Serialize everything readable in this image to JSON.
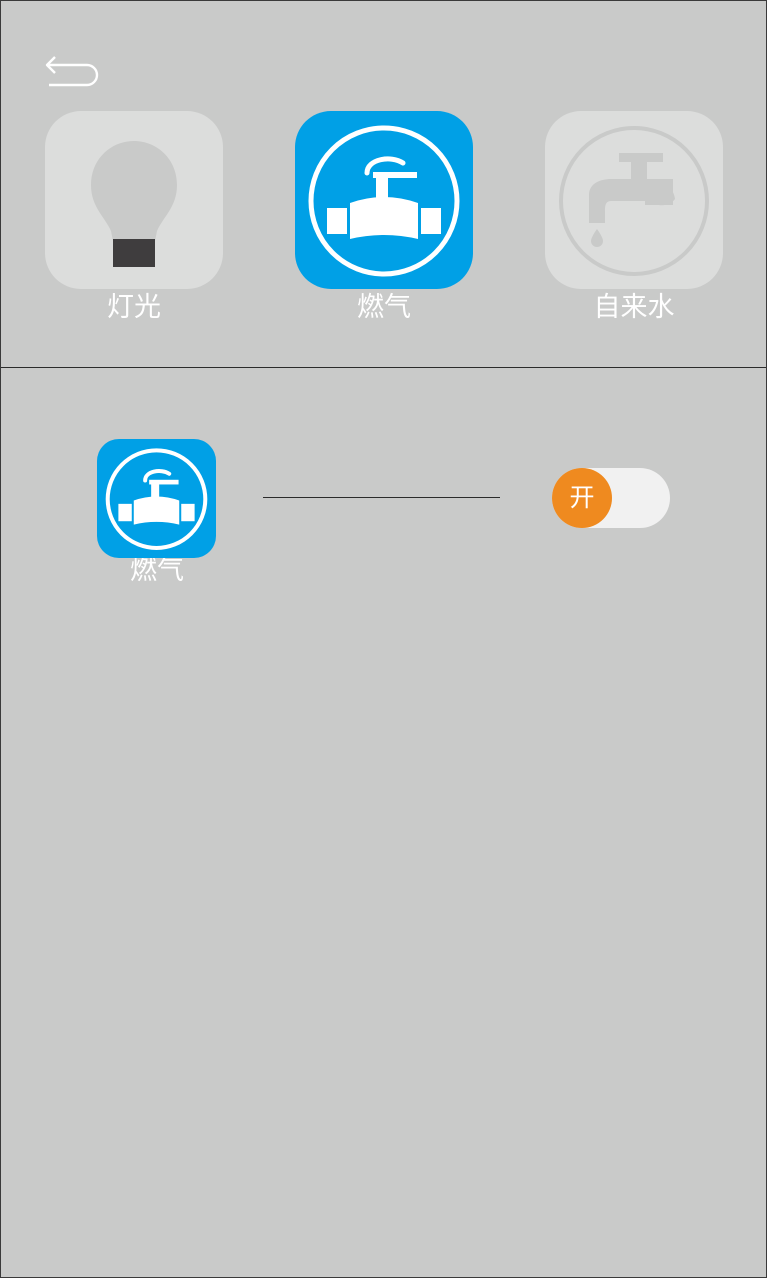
{
  "header": {
    "back_icon": "back-arrow-icon"
  },
  "categories": [
    {
      "label": "灯光",
      "icon": "light-bulb-icon",
      "selected": false
    },
    {
      "label": "燃气",
      "icon": "gas-valve-icon",
      "selected": true
    },
    {
      "label": "自来水",
      "icon": "water-faucet-icon",
      "selected": false
    }
  ],
  "device": {
    "label": "燃气",
    "icon": "gas-valve-icon",
    "toggle_label": "开",
    "toggle_on": true
  },
  "colors": {
    "background": "#c9cac9",
    "selected_tile": "#00a0e6",
    "unselected_tile": "#dcdddc",
    "toggle_knob": "#ef8a1f",
    "toggle_track": "#f1f1f1"
  }
}
